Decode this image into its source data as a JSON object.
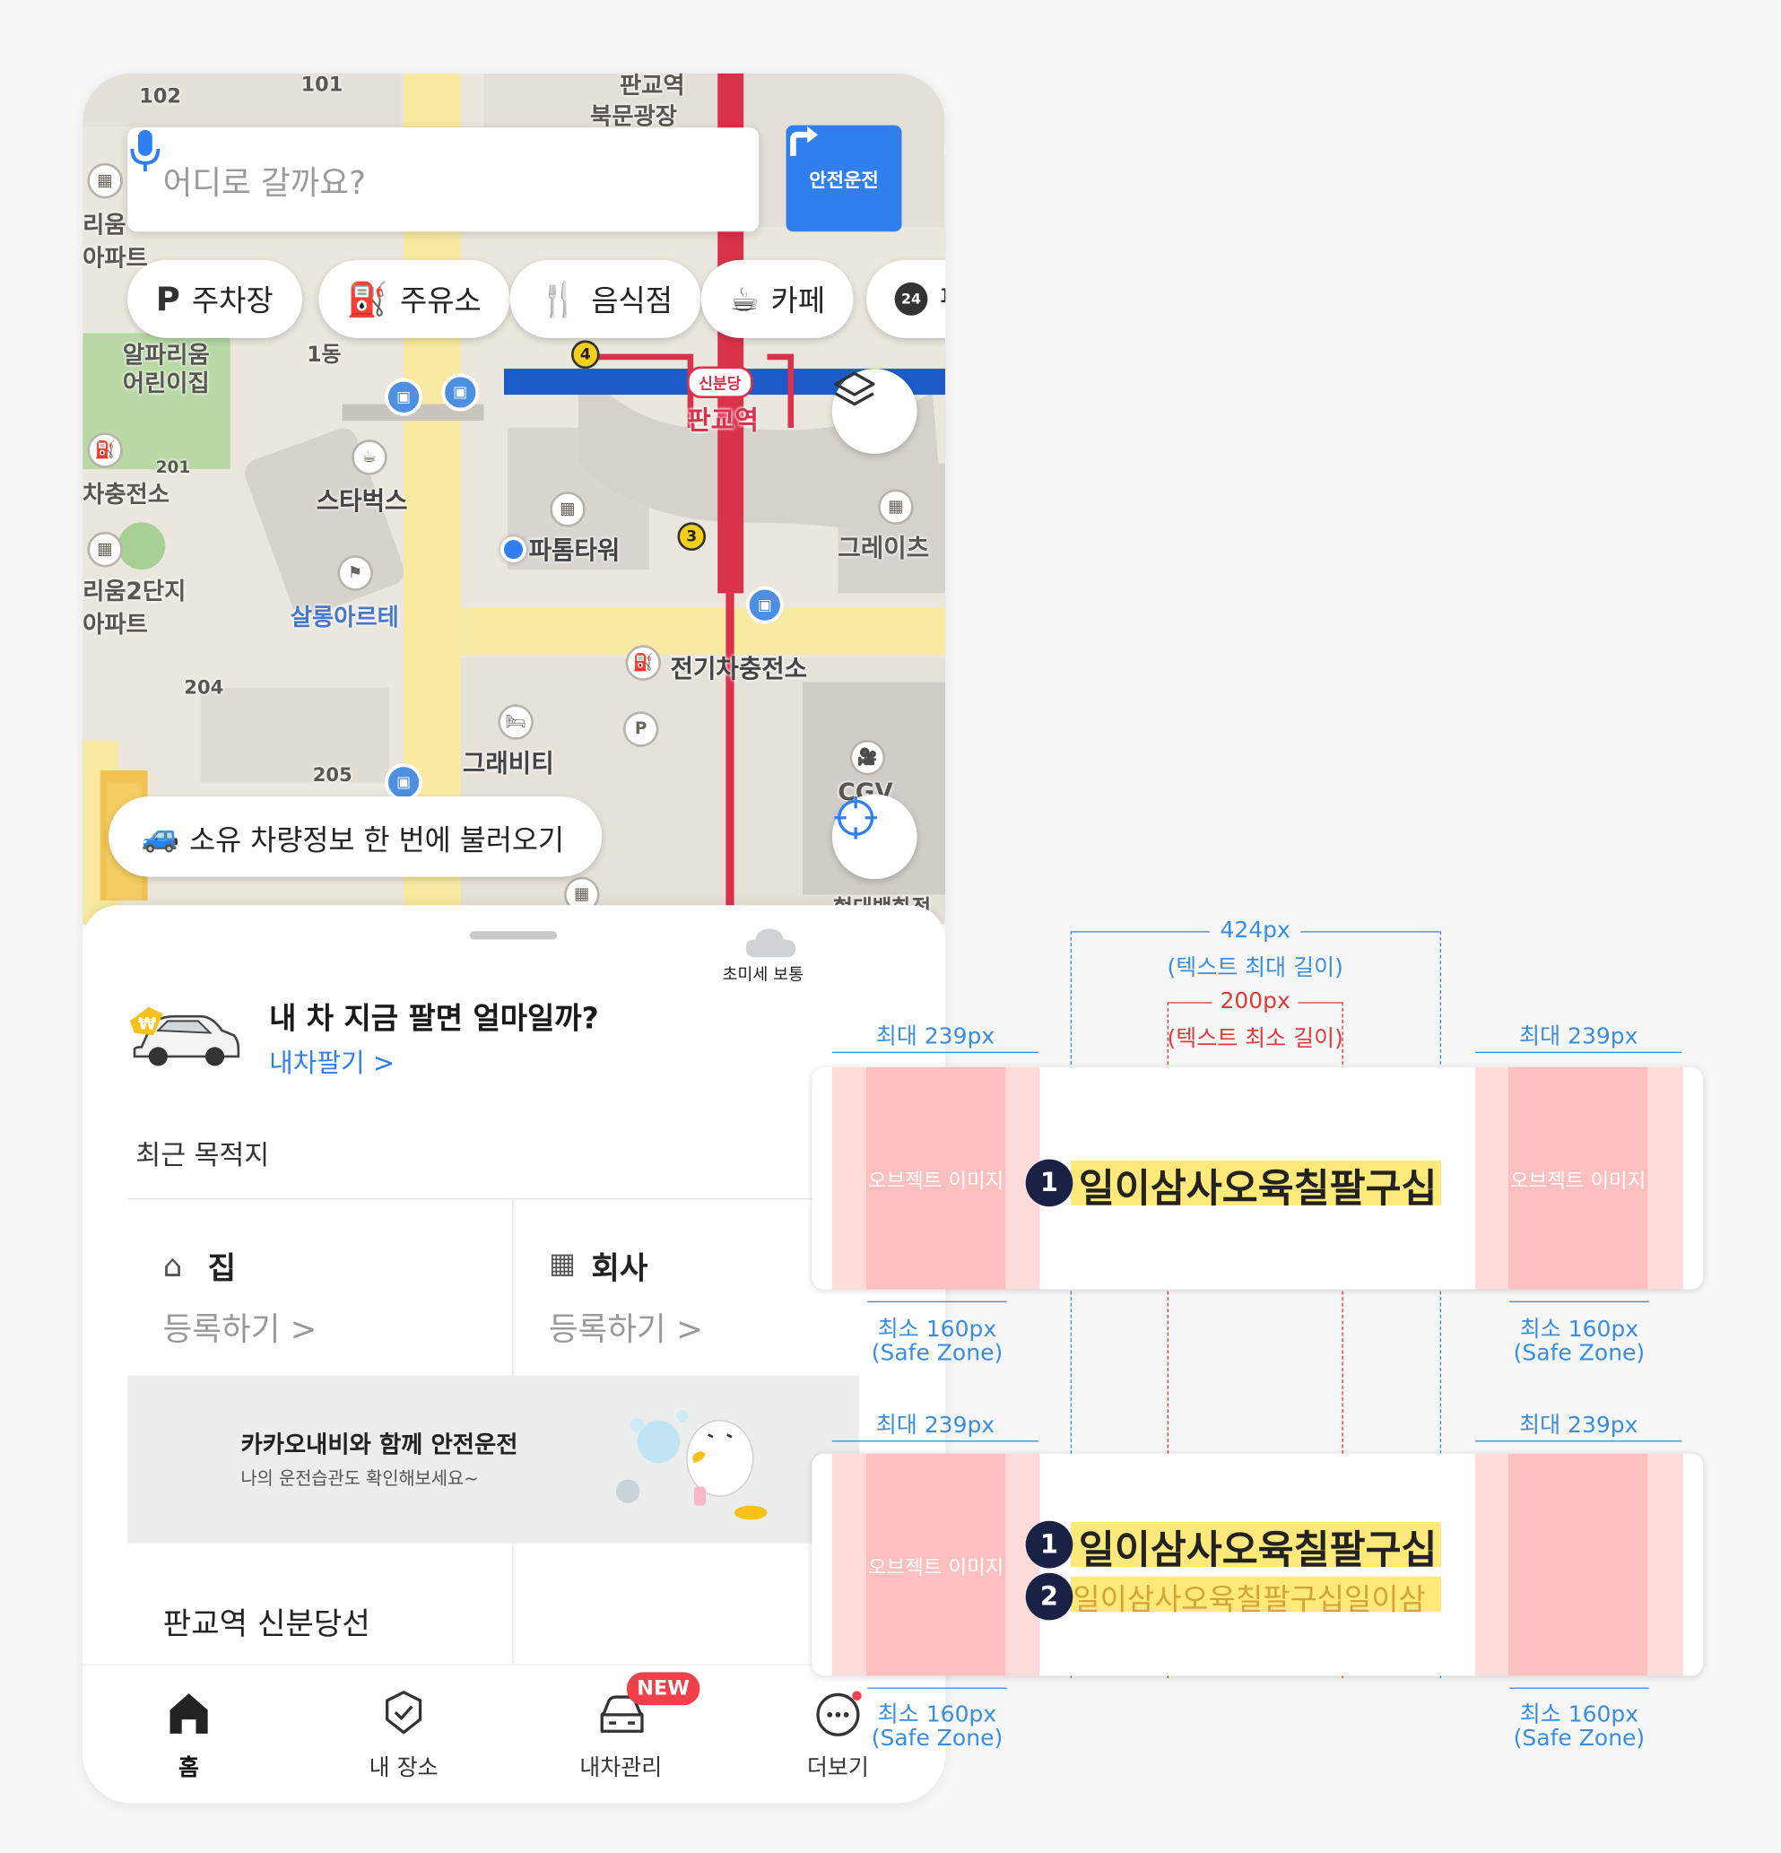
{
  "search": {
    "placeholder": "어디로 갈까요?",
    "safe_drive_label": "안전운전"
  },
  "chips": [
    {
      "icon": "parking-icon",
      "label": "주차장"
    },
    {
      "icon": "gas-station-icon",
      "label": "주유소"
    },
    {
      "icon": "restaurant-icon",
      "label": "음식점"
    },
    {
      "icon": "cafe-icon",
      "label": "카페"
    },
    {
      "icon": "24h-store-icon",
      "label": "편"
    }
  ],
  "map": {
    "labels": [
      "102",
      "101",
      "판교역",
      "북문광장",
      "리움",
      "아파트",
      "알파리움",
      "어린이집",
      "1동",
      "201",
      "차충전소",
      "스타벅스",
      "신분당",
      "판교역",
      "파톰타워",
      "그레이츠",
      "리움2단지",
      "아파트",
      "살롱아르테",
      "204",
      "전기차충전소",
      "그래비티",
      "205",
      "CGV",
      "현대백화점"
    ],
    "exits": [
      "4",
      "3"
    ]
  },
  "car_info_pill": "소유 차량정보 한 번에 불러오기",
  "sheet": {
    "sell_title": "내 차 지금 팔면 얼마일까?",
    "sell_link": "내차팔기 >",
    "weather": "초미세 보통",
    "recent_title": "최근 목적지",
    "home": {
      "title": "집",
      "action": "등록하기 >"
    },
    "work": {
      "title": "회사",
      "action": "등록하기 >"
    },
    "banner_title": "카카오내비와 함께 안전운전",
    "banner_sub": "나의 운전습관도 확인해보세요~",
    "route": "판교역 신분당선"
  },
  "tabbar": [
    {
      "icon": "home-icon",
      "label": "홈",
      "active": true
    },
    {
      "icon": "my-place-icon",
      "label": "내 장소"
    },
    {
      "icon": "car-manage-icon",
      "label": "내차관리",
      "badge": "NEW"
    },
    {
      "icon": "more-icon",
      "label": "더보기"
    }
  ],
  "spec": {
    "max_text": "424px",
    "max_text_desc": "(텍스트 최대 길이)",
    "min_text": "200px",
    "min_text_desc": "(텍스트 최소 길이)",
    "max_side": "최대 239px",
    "min_side": "최소 160px",
    "safe_zone": "(Safe Zone)",
    "object_image": "오브젝트 이미지",
    "line1": "일이삼사오육칠팔구십",
    "line2": "일이삼사오육칠팔구십일이삼",
    "num1": "1",
    "num2": "2"
  },
  "colors": {
    "accent": "#2f80ee",
    "safe_zone_dark": "#fec0be",
    "safe_zone_light": "#ffdcdc",
    "highlight": "#ffe97a",
    "badge": "#f2414c",
    "max_dim": "#3a8ee0",
    "min_dim": "#e03a3a"
  }
}
